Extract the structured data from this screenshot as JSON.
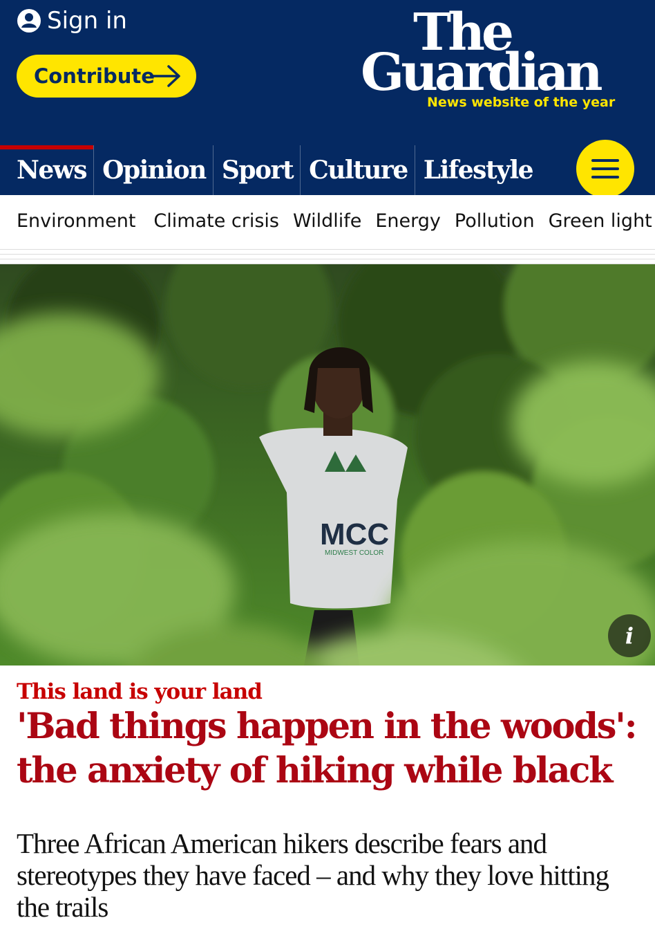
{
  "header": {
    "sign_in_label": "Sign in",
    "contribute_label": "Contribute",
    "logo_line1": "The",
    "logo_line2": "Guardian",
    "logo_tagline": "News website of the year",
    "brand_blue": "#052962",
    "brand_yellow": "#ffe500"
  },
  "pillars": [
    {
      "label": "News",
      "active": true
    },
    {
      "label": "Opinion"
    },
    {
      "label": "Sport"
    },
    {
      "label": "Culture"
    },
    {
      "label": "Lifestyle"
    }
  ],
  "menu_icon": "hamburger-icon",
  "subnav": {
    "items": [
      "Environment",
      "Climate crisis",
      "Wildlife",
      "Energy",
      "Pollution",
      "Green light"
    ],
    "marker_icon": "red-triangle-icon",
    "marker_color": "#c70000"
  },
  "hero": {
    "description_icon": "info-icon",
    "info_label": "i",
    "shirt_text": "MCC",
    "shirt_subtext": "MIDWEST COLOR"
  },
  "article": {
    "kicker": "This land is your land",
    "headline": "'Bad things happen in the woods': the anxiety of hiking while black",
    "standfirst": "Three African American hikers describe fears and stereotypes they have faced – and why they love hitting the trails",
    "headline_color": "#ab0613",
    "kicker_color": "#c70000"
  }
}
